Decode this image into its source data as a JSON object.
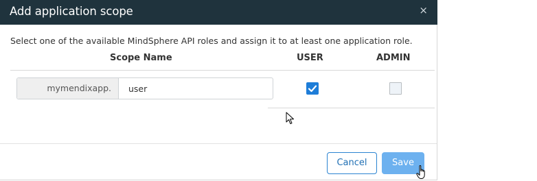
{
  "dialog": {
    "title": "Add application scope",
    "close_glyph": "×",
    "description": "Select one of the available MindSphere API roles and assign it to at least one application role."
  },
  "table": {
    "headers": {
      "scope_name": "Scope Name",
      "user": "USER",
      "admin": "ADMIN"
    },
    "rows": [
      {
        "prefix": "mymendixapp.",
        "scope_value": "user",
        "user_checked": true,
        "admin_checked": false
      }
    ]
  },
  "buttons": {
    "cancel": "Cancel",
    "save": "Save"
  },
  "colors": {
    "titlebar": "#1f333d",
    "accent": "#1e7dd8",
    "save_button": "#6db1ef"
  },
  "icons": {
    "close": "close-icon",
    "check": "check-icon",
    "arrow_cursor": "arrow-cursor-icon",
    "hand_cursor": "hand-cursor-icon"
  }
}
